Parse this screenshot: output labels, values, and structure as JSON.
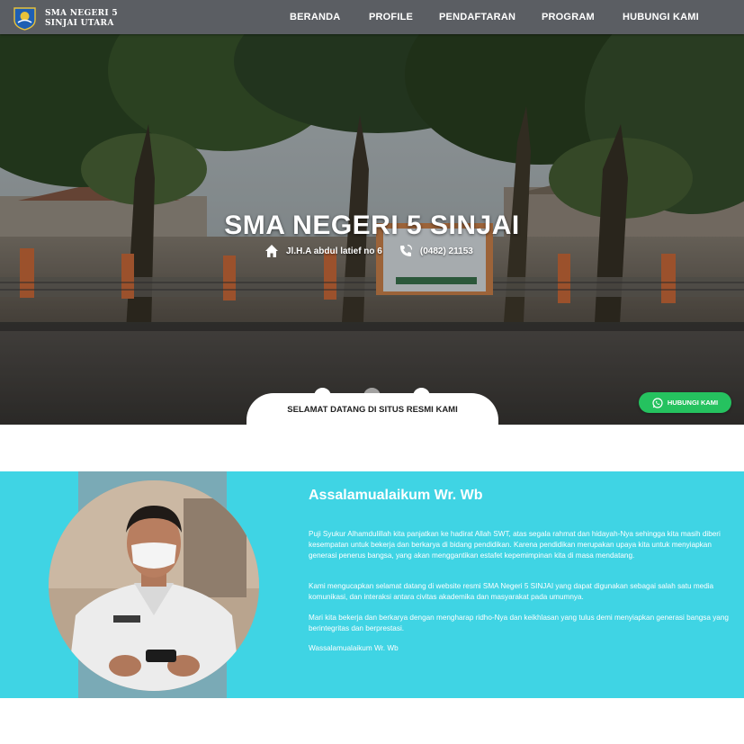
{
  "brand": {
    "line1": "SMA NEGERI 5",
    "line2": "SINJAI UTARA"
  },
  "nav": [
    "BERANDA",
    "PROFILE",
    "PENDAFTARAN",
    "PROGRAM",
    "HUBUNGI KAMI"
  ],
  "hero": {
    "title": "SMA NEGERI 5 SINJAI",
    "address": "Jl.H.A abdul latief no 6",
    "phone": "(0482) 21153",
    "slides": 3,
    "active_slide": 1
  },
  "welcome_tab": "SELAMAT DATANG DI SITUS RESMI KAMI",
  "whatsapp_button": "HUBUNGI KAMI",
  "about": {
    "greeting": "Assalamualaikum Wr. Wb",
    "p1": "Puji Syukur Alhamdulillah kita panjatkan ke hadirat Allah SWT, atas segala rahmat dan hidayah-Nya sehingga kita masih diberi kesempatan untuk bekerja dan berkarya di bidang pendidikan. Karena pendidikan merupakan upaya kita untuk menyiapkan generasi penerus bangsa, yang akan menggantikan estafet kepemimpinan kita di masa mendatang.",
    "p2": "Kami mengucapkan selamat datang di website resmi SMA Negeri 5 SINJAI yang dapat digunakan sebagai salah satu media komunikasi, dan interaksi antara civitas akademika dan masyarakat pada umumnya.",
    "p3": "Mari kita bekerja dan berkarya dengan mengharap ridho-Nya dan keikhlasan yang tulus demi menyiapkan generasi bangsa yang berintegritas dan berprestasi.",
    "closing": "Wassalamualaikum Wr. Wb"
  },
  "colors": {
    "navbar": "#5b5e63",
    "section": "#3fd4e4",
    "whatsapp": "#25c25f"
  }
}
